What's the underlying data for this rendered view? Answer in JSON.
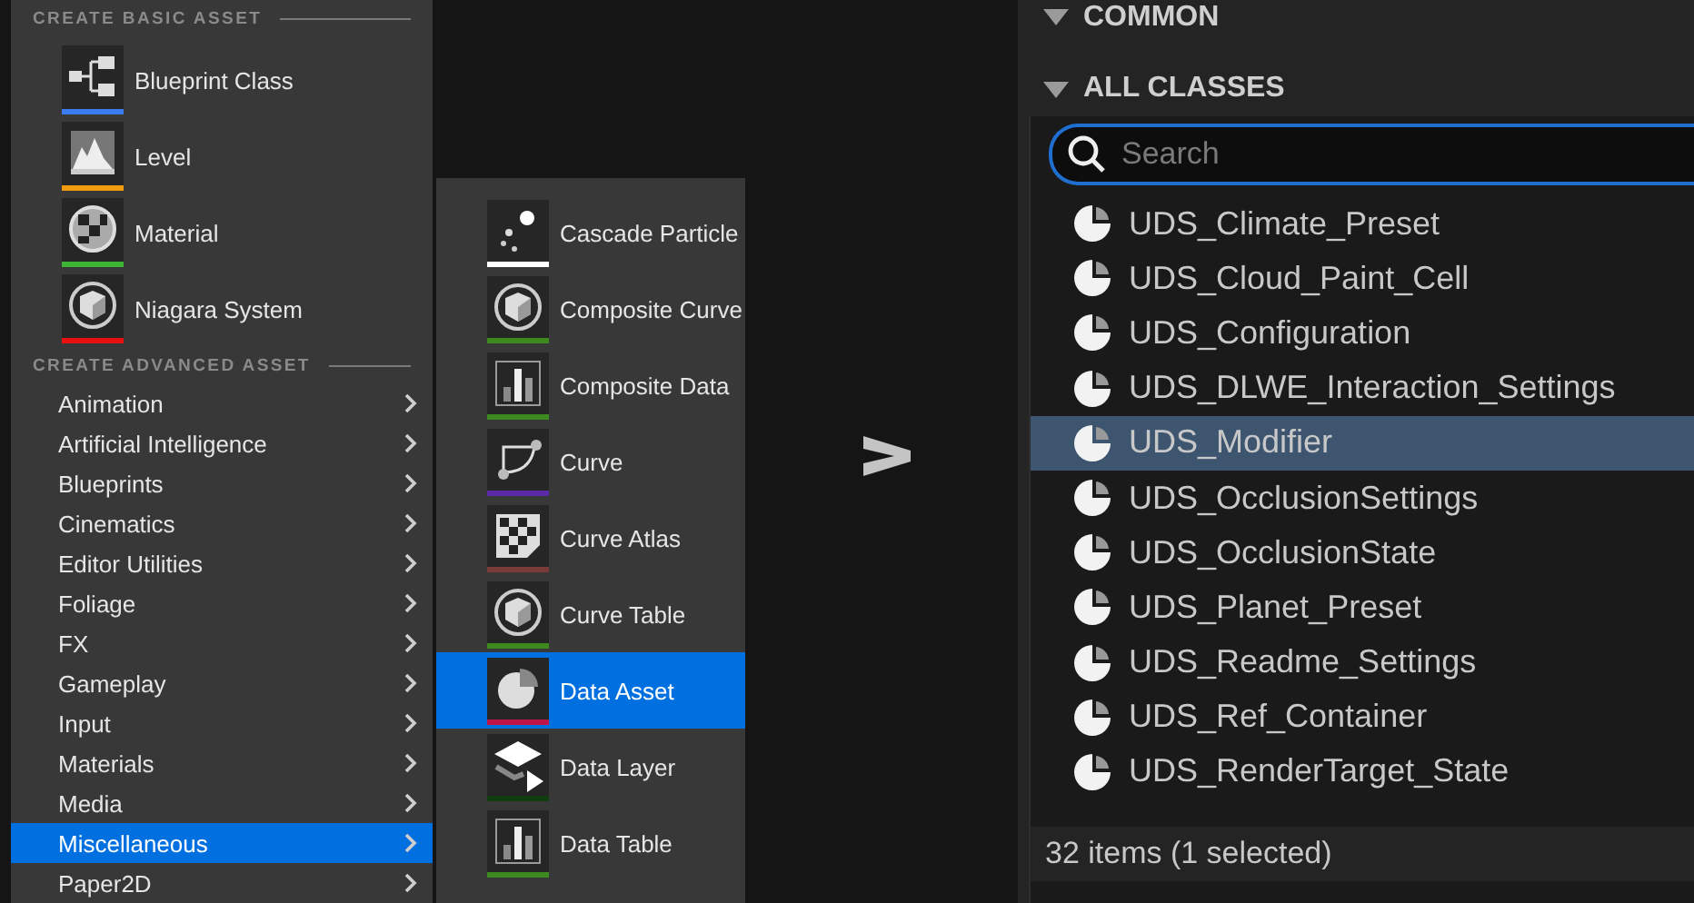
{
  "create_menu": {
    "basic_header": "CREATE BASIC ASSET",
    "basic_assets": [
      {
        "label": "Blueprint Class",
        "kind": "blueprint",
        "color": "#3b7bf0"
      },
      {
        "label": "Level",
        "kind": "level",
        "color": "#f29a0d"
      },
      {
        "label": "Material",
        "kind": "material",
        "color": "#3cb532"
      },
      {
        "label": "Niagara System",
        "kind": "cube",
        "color": "#e81010"
      }
    ],
    "advanced_header": "CREATE ADVANCED ASSET",
    "categories": [
      {
        "label": "Animation",
        "selected": false
      },
      {
        "label": "Artificial Intelligence",
        "selected": false
      },
      {
        "label": "Blueprints",
        "selected": false
      },
      {
        "label": "Cinematics",
        "selected": false
      },
      {
        "label": "Editor Utilities",
        "selected": false
      },
      {
        "label": "Foliage",
        "selected": false
      },
      {
        "label": "FX",
        "selected": false
      },
      {
        "label": "Gameplay",
        "selected": false
      },
      {
        "label": "Input",
        "selected": false
      },
      {
        "label": "Materials",
        "selected": false
      },
      {
        "label": "Media",
        "selected": false
      },
      {
        "label": "Miscellaneous",
        "selected": true
      },
      {
        "label": "Paper2D",
        "selected": false
      }
    ]
  },
  "submenu": {
    "items": [
      {
        "label": "Cascade Particle",
        "kind": "particle",
        "color": "#ffffff",
        "selected": false
      },
      {
        "label": "Composite Curve",
        "kind": "cube",
        "color": "#3c8a1e",
        "selected": false
      },
      {
        "label": "Composite Data",
        "kind": "chart",
        "color": "#3c8a1e",
        "selected": false
      },
      {
        "label": "Curve",
        "kind": "curve",
        "color": "#5a2aa8",
        "selected": false
      },
      {
        "label": "Curve Atlas",
        "kind": "atlas",
        "color": "#7a3a3a",
        "selected": false
      },
      {
        "label": "Curve Table",
        "kind": "cube",
        "color": "#3c8a1e",
        "selected": false
      },
      {
        "label": "Data Asset",
        "kind": "pie",
        "color": "#c0134a",
        "selected": true
      },
      {
        "label": "Data Layer",
        "kind": "layer",
        "color": "#0f3d0f",
        "selected": false
      },
      {
        "label": "Data Table",
        "kind": "chart",
        "color": "#3c8a1e",
        "selected": false
      }
    ]
  },
  "class_picker": {
    "sections": [
      {
        "label": "COMMON",
        "expanded": true
      },
      {
        "label": "ALL CLASSES",
        "expanded": true
      }
    ],
    "search": {
      "placeholder": "Search"
    },
    "classes": [
      {
        "label": "UDS_Climate_Preset",
        "selected": false
      },
      {
        "label": "UDS_Cloud_Paint_Cell",
        "selected": false
      },
      {
        "label": "UDS_Configuration",
        "selected": false
      },
      {
        "label": "UDS_DLWE_Interaction_Settings",
        "selected": false
      },
      {
        "label": "UDS_Modifier",
        "selected": true
      },
      {
        "label": "UDS_OcclusionSettings",
        "selected": false
      },
      {
        "label": "UDS_OcclusionState",
        "selected": false
      },
      {
        "label": "UDS_Planet_Preset",
        "selected": false
      },
      {
        "label": "UDS_Readme_Settings",
        "selected": false
      },
      {
        "label": "UDS_Ref_Container",
        "selected": false
      },
      {
        "label": "UDS_RenderTarget_State",
        "selected": false
      }
    ],
    "status": "32 items (1 selected)"
  }
}
